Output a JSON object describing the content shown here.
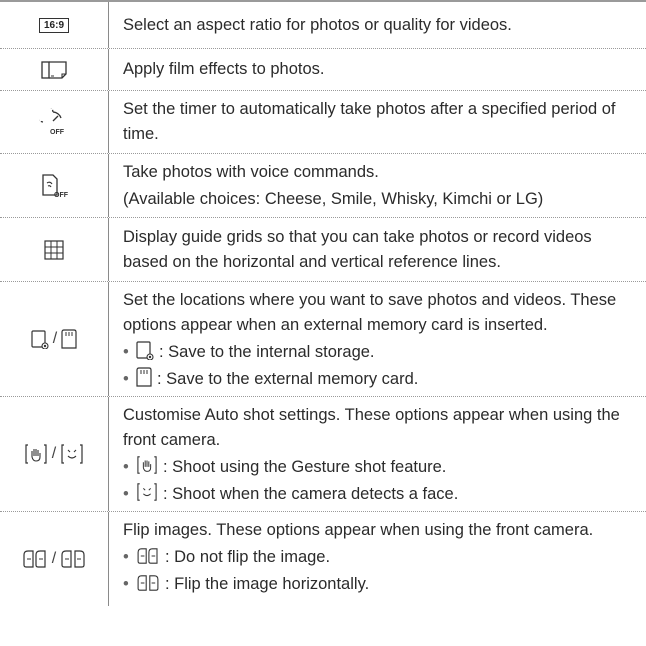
{
  "rows": [
    {
      "icon_name": "aspect-ratio-icon",
      "icon_text": "16:9",
      "lines": [
        "Select an aspect ratio for photos or quality for videos."
      ]
    },
    {
      "icon_name": "film-effect-icon",
      "lines": [
        "Apply film effects to photos."
      ]
    },
    {
      "icon_name": "timer-off-icon",
      "icon_text": "OFF",
      "lines": [
        "Set the timer to automatically take photos after a specified period of time."
      ]
    },
    {
      "icon_name": "voice-shutter-off-icon",
      "icon_text": "OFF",
      "lines": [
        "Take photos with voice commands.",
        "(Available choices: Cheese, Smile, Whisky, Kimchi or LG)"
      ]
    },
    {
      "icon_name": "grid-icon",
      "lines": [
        "Display guide grids so that you can take photos or record videos based on the horizontal and vertical reference lines."
      ]
    },
    {
      "icon_name": "storage-icons",
      "separator": "/",
      "lines": [
        "Set the locations where you want to save photos and videos. These options appear when an external memory card is inserted."
      ],
      "bullets": [
        {
          "icon": "internal-storage-icon",
          "text": ": Save to the internal storage."
        },
        {
          "icon": "memory-card-icon",
          "text": ": Save to the external memory card."
        }
      ]
    },
    {
      "icon_name": "auto-shot-icons",
      "separator": "/",
      "lines": [
        "Customise Auto shot settings. These options appear when using the front camera."
      ],
      "bullets": [
        {
          "icon": "gesture-shot-icon",
          "text": ": Shoot using the Gesture shot feature."
        },
        {
          "icon": "face-detect-icon",
          "text": ": Shoot when the camera detects a face."
        }
      ]
    },
    {
      "icon_name": "flip-icons",
      "separator": "/",
      "lines": [
        "Flip images. These options appear when using the front camera."
      ],
      "bullets": [
        {
          "icon": "no-flip-icon",
          "text": ": Do not flip the image."
        },
        {
          "icon": "flip-horizontal-icon",
          "text": ": Flip the image horizontally."
        }
      ]
    }
  ],
  "bullet_char": "•"
}
